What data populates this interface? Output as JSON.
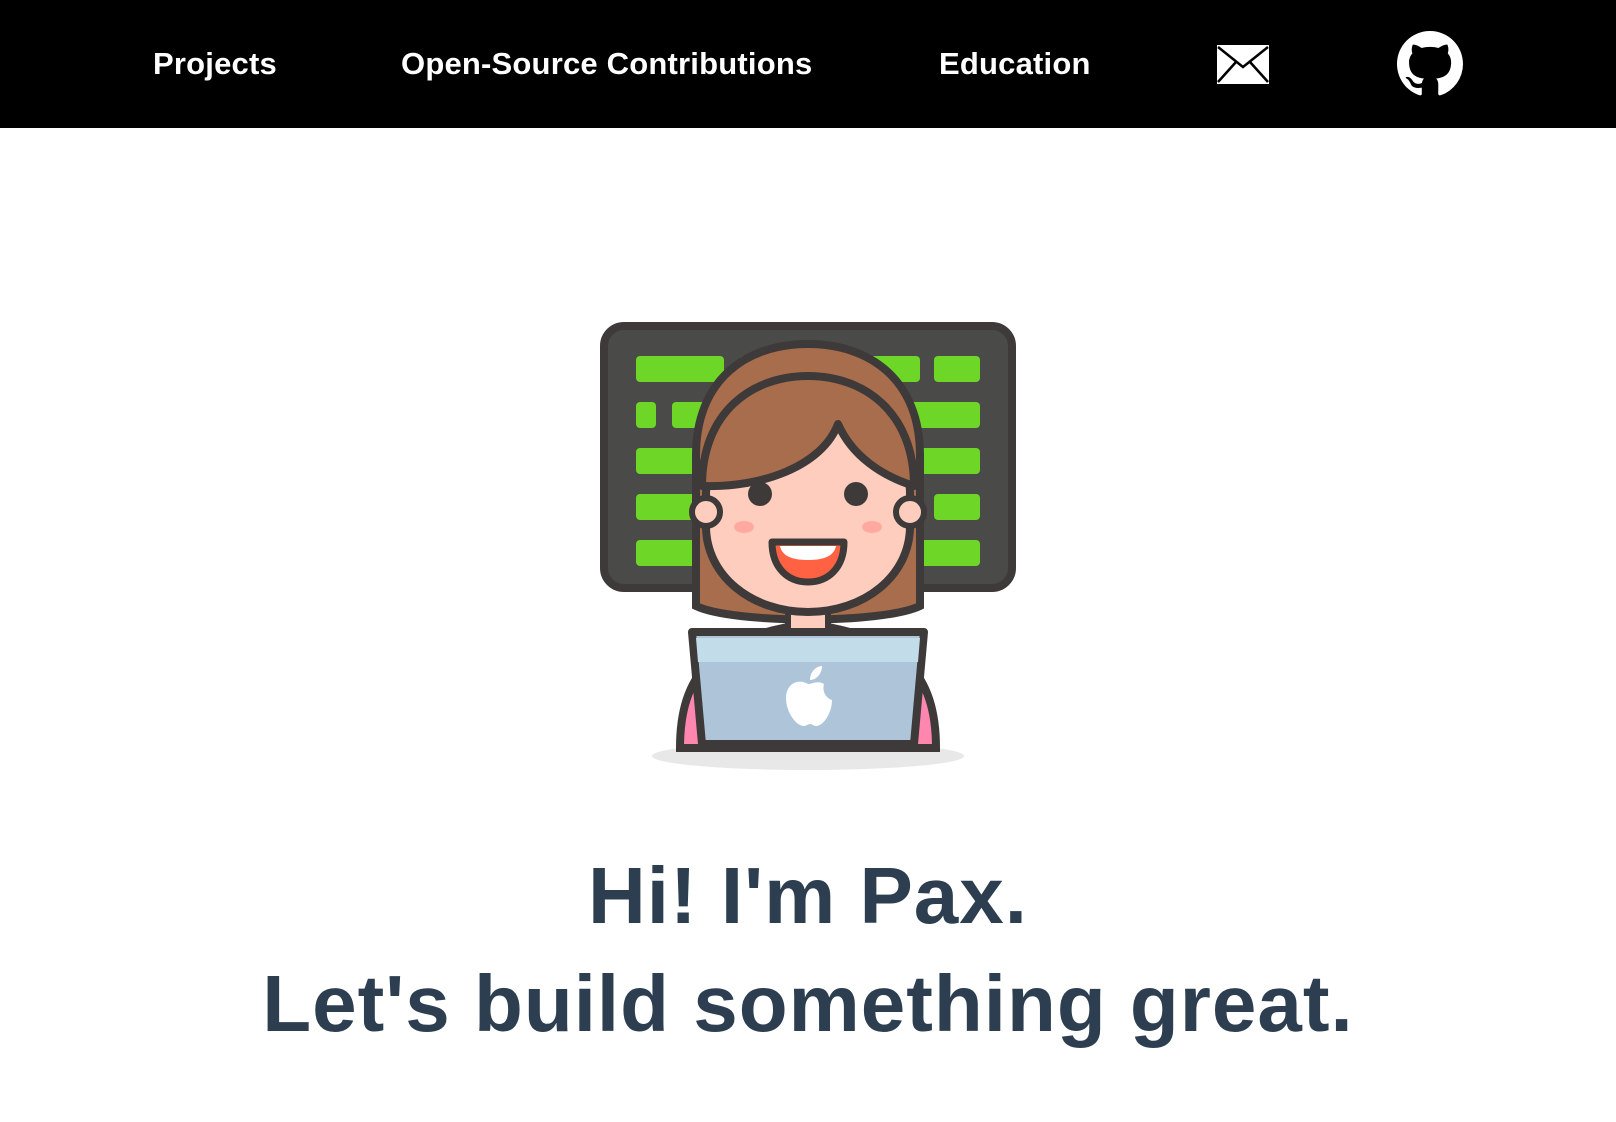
{
  "nav": {
    "links": [
      {
        "label": "Projects"
      },
      {
        "label": "Open-Source Contributions"
      },
      {
        "label": "Education"
      }
    ],
    "icons": [
      {
        "name": "mail-icon"
      },
      {
        "name": "github-icon"
      }
    ]
  },
  "hero": {
    "illustration": "woman-coding-illustration",
    "line1": "Hi! I'm Pax.",
    "line2": "Let's build something great."
  },
  "colors": {
    "navbar_bg": "#000000",
    "nav_text": "#ffffff",
    "heading": "#2c3e50",
    "screen_bg": "#4a4a48",
    "code_green": "#6dd627",
    "hair": "#a86d4c",
    "skin": "#ffcdbe",
    "shirt": "#ff87af",
    "laptop": "#adc4d9"
  }
}
